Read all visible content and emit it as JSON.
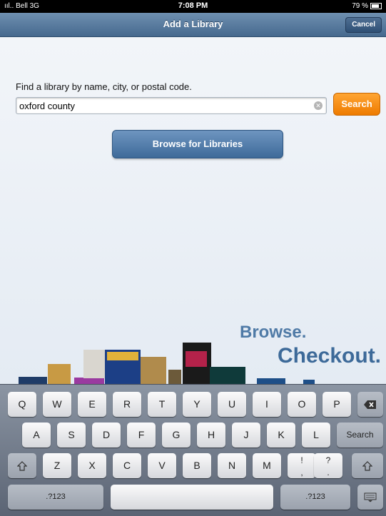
{
  "status_bar": {
    "carrier": "ııl.. Bell 3G",
    "time": "7:08 PM",
    "battery": "79 %"
  },
  "navbar": {
    "title": "Add a Library",
    "cancel_label": "Cancel"
  },
  "search": {
    "prompt": "Find a library by name, city, or postal code.",
    "value": "oxford county",
    "button_label": "Search"
  },
  "browse_button_label": "Browse for Libraries",
  "promo": {
    "line1": "Browse.",
    "line2": "Checkout."
  },
  "keyboard": {
    "row1": [
      "Q",
      "W",
      "E",
      "R",
      "T",
      "Y",
      "U",
      "I",
      "O",
      "P"
    ],
    "row2": [
      "A",
      "S",
      "D",
      "F",
      "G",
      "H",
      "J",
      "K",
      "L"
    ],
    "row3": [
      "Z",
      "X",
      "C",
      "V",
      "B",
      "N",
      "M"
    ],
    "search_key": "Search",
    "num_key_left": ".?123",
    "num_key_right": ".?123",
    "punct1": [
      "!",
      ","
    ],
    "punct2": [
      "?",
      "."
    ]
  },
  "colors": {
    "nav_blue": "#46698e",
    "search_orange": "#ee7b00",
    "browse_blue": "#3e6a99"
  }
}
